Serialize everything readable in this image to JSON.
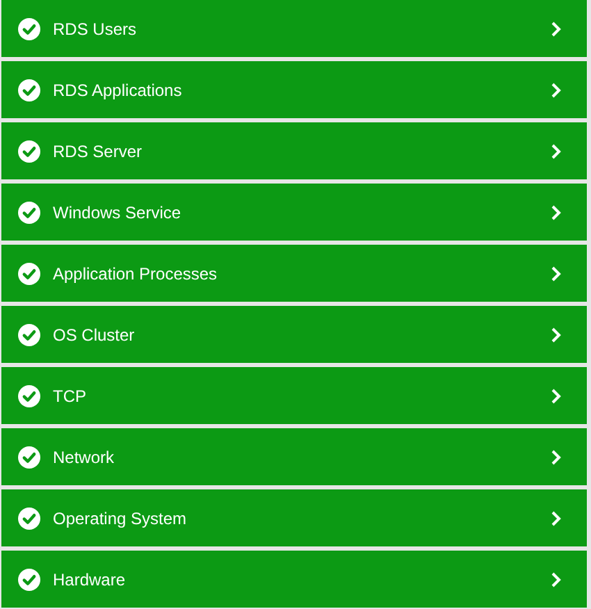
{
  "items": [
    {
      "label": "RDS Users",
      "ok": true
    },
    {
      "label": "RDS Applications",
      "ok": true
    },
    {
      "label": "RDS Server",
      "ok": true
    },
    {
      "label": "Windows Service",
      "ok": true
    },
    {
      "label": "Application Processes",
      "ok": true
    },
    {
      "label": "OS Cluster",
      "ok": true
    },
    {
      "label": "TCP",
      "ok": true
    },
    {
      "label": "Network",
      "ok": true
    },
    {
      "label": "Operating System",
      "ok": true
    },
    {
      "label": "Hardware",
      "ok": true
    }
  ]
}
